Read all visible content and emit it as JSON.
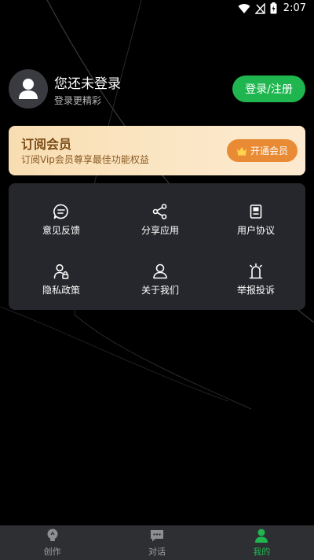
{
  "status_bar": {
    "time": "2:07"
  },
  "profile": {
    "name": "您还未登录",
    "subtitle": "登录更精彩",
    "login_button": "登录/注册"
  },
  "vip": {
    "title": "订阅会员",
    "description": "订阅Vip会员尊享最佳功能权益",
    "button": "开通会员"
  },
  "menu": {
    "items": [
      {
        "label": "意见反馈",
        "icon": "feedback-icon"
      },
      {
        "label": "分享应用",
        "icon": "share-icon"
      },
      {
        "label": "用户协议",
        "icon": "agreement-icon"
      },
      {
        "label": "隐私政策",
        "icon": "privacy-icon"
      },
      {
        "label": "关于我们",
        "icon": "about-icon"
      },
      {
        "label": "举报投诉",
        "icon": "report-icon"
      }
    ]
  },
  "tabbar": {
    "tabs": [
      {
        "label": "创作",
        "icon": "bulb-icon",
        "active": false
      },
      {
        "label": "对话",
        "icon": "chat-icon",
        "active": false
      },
      {
        "label": "我的",
        "icon": "user-icon",
        "active": true
      }
    ]
  },
  "colors": {
    "accent": "#1fb650",
    "vip_button": "#e98b35",
    "card_bg": "#26272c"
  }
}
